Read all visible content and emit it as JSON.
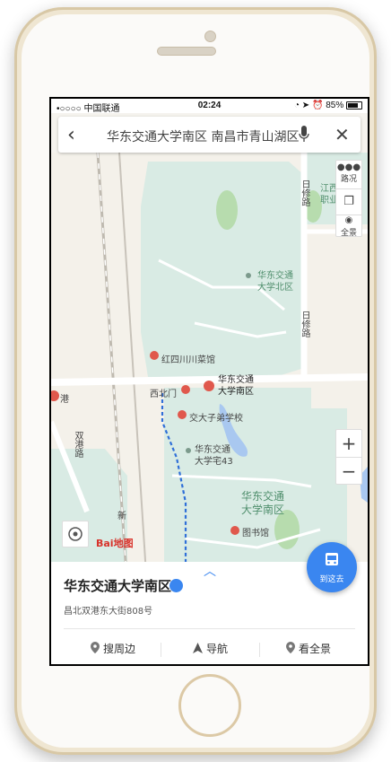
{
  "statusbar": {
    "carrier": "•○○○○ 中国联通",
    "time": "02:24",
    "battery": "85%"
  },
  "search": {
    "query": "华东交通大学南区 南昌市青山湖区"
  },
  "map": {
    "labels": {
      "north_campus": "华东交通\n大学北区",
      "hongsi": "红四川川菜馆",
      "xibeimen": "西北门",
      "south_campus_small": "华东交通\n大学南区",
      "school": "交大子弟学校",
      "housing": "华东交通\n大学宅43",
      "south_campus_big": "华东交通\n大学南区",
      "library": "图书馆",
      "shuanggang": "双港路",
      "rixiu_top": "日修路",
      "rixiu_mid": "日修路",
      "gang": "港",
      "xin": "新",
      "jiangxi_partial": "江西\n职业"
    },
    "controls": {
      "traffic": "路况",
      "streetview": "全景",
      "zoom_in": "+",
      "zoom_out": "−"
    },
    "baidu_logo_text": "Bai地图"
  },
  "go_here": {
    "label": "到这去"
  },
  "panel": {
    "title": "华东交通大学南区",
    "address": "昌北双港东大街808号",
    "actions": {
      "nearby": "搜周边",
      "navigate": "导航",
      "panorama": "看全景"
    }
  },
  "colors": {
    "accent": "#3a86f0",
    "campus": "#d9ebe4",
    "park": "#b7dcae",
    "water": "#a9c8f0",
    "road": "#ffffff"
  }
}
